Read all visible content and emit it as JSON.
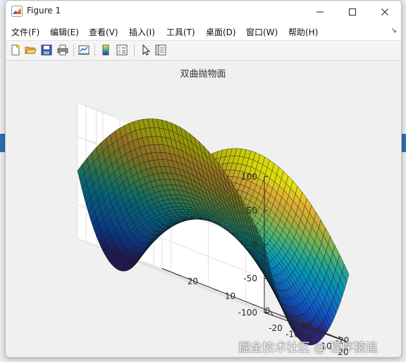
{
  "window": {
    "title": "Figure 1",
    "controls": {
      "minimize": "minimize",
      "maximize": "maximize",
      "close": "close"
    }
  },
  "menu": [
    {
      "label": "文件(F)"
    },
    {
      "label": "编辑(E)"
    },
    {
      "label": "查看(V)"
    },
    {
      "label": "插入(I)"
    },
    {
      "label": "工具(T)"
    },
    {
      "label": "桌面(D)"
    },
    {
      "label": "窗口(W)"
    },
    {
      "label": "帮助(H)"
    }
  ],
  "toolbar": [
    "new-figure-icon",
    "open-file-icon",
    "save-icon",
    "print-icon",
    "link-plot-icon",
    "colorbar-icon",
    "legend-icon",
    "edit-plot-icon",
    "property-inspector-icon"
  ],
  "chart_data": {
    "type": "surface",
    "title": "双曲抛物面",
    "function": "z = x^2/5 - y^2/5",
    "x": {
      "range": [
        -25,
        25
      ],
      "ticks": [
        -20,
        -10,
        0,
        10,
        20
      ]
    },
    "y": {
      "range": [
        -25,
        25
      ],
      "ticks": [
        -20,
        -10,
        0,
        10,
        20
      ]
    },
    "z": {
      "range": [
        -100,
        100
      ],
      "ticks": [
        -100,
        -50,
        0,
        50,
        100
      ]
    },
    "grid": true,
    "colormap": "parula",
    "xlabel": "",
    "ylabel": "",
    "zlabel": ""
  },
  "watermark": "掘金技术社区 @ 程序猿追"
}
